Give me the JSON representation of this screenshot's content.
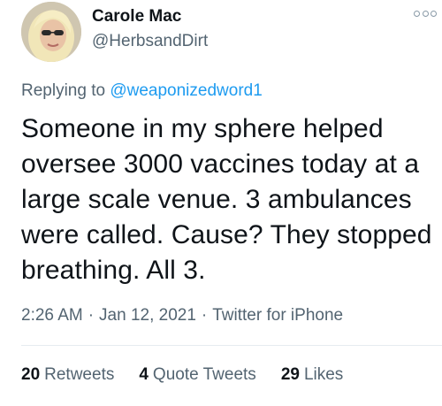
{
  "author": {
    "name": "Carole Mac",
    "handle": "@HerbsandDirt"
  },
  "reply": {
    "prefix": "Replying to",
    "mention": "@weaponizedword1"
  },
  "tweet_text": "Someone in my sphere helped oversee 3000 vaccines today at a large scale venue. 3 ambulances were called. Cause? They stopped breathing. All 3.",
  "meta": {
    "time": "2:26 AM",
    "separator": "·",
    "date": "Jan 12, 2021",
    "source": "Twitter for iPhone"
  },
  "stats": {
    "retweets_count": "20",
    "retweets_label": "Retweets",
    "quote_count": "4",
    "quote_label": "Quote Tweets",
    "likes_count": "29",
    "likes_label": "Likes"
  },
  "icons": {
    "more": "more-options-icon"
  },
  "colors": {
    "mention": "#1d9bf0",
    "secondary_text": "#536471",
    "primary_text": "#0f1419"
  }
}
